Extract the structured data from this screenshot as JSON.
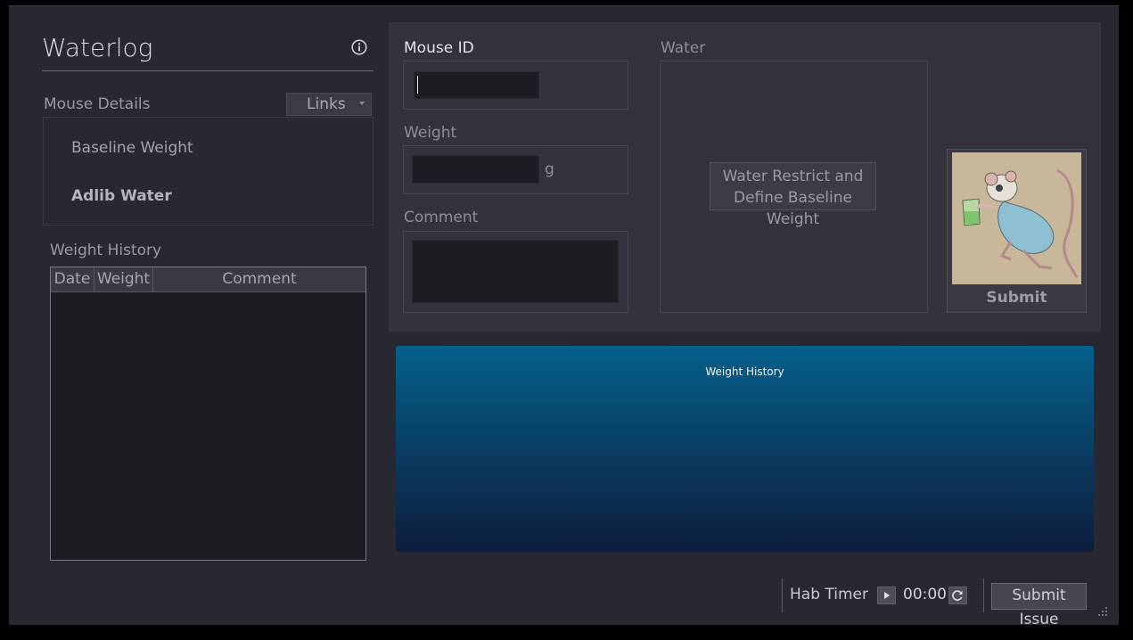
{
  "app": {
    "title": "Waterlog"
  },
  "mouse_details": {
    "label": "Mouse Details",
    "links_button": "Links",
    "items": [
      {
        "label": "Baseline Weight"
      },
      {
        "label": "Adlib Water"
      }
    ]
  },
  "weight_history": {
    "label": "Weight History",
    "columns": [
      "Date",
      "Weight",
      "Comment"
    ],
    "rows": []
  },
  "form": {
    "mouse_id_label": "Mouse ID",
    "mouse_id_value": "",
    "weight_label": "Weight",
    "weight_value": "",
    "weight_unit": "g",
    "comment_label": "Comment",
    "comment_value": "",
    "water_label": "Water",
    "water_button": "Water Restrict and Define Baseline Weight",
    "water_button_line1": "Water Restrict and",
    "water_button_line2": "Define Baseline Weight",
    "submit_label": "Submit"
  },
  "chart": {
    "title": "Weight History"
  },
  "footer": {
    "hab_timer_label": "Hab Timer",
    "timer_value": "00:00",
    "submit_issue": "Submit Issue"
  },
  "icons": {
    "info": "info-icon",
    "play": "play-icon",
    "refresh": "refresh-icon",
    "dropdown": "chevron-down-icon",
    "submit_image": "mouse-drinking-illustration"
  },
  "colors": {
    "window_bg": "#282831",
    "panel_bg": "#33333d",
    "input_bg": "#1d1c22",
    "chart_top": "#04608b",
    "chart_bottom": "#0d1d3b"
  }
}
